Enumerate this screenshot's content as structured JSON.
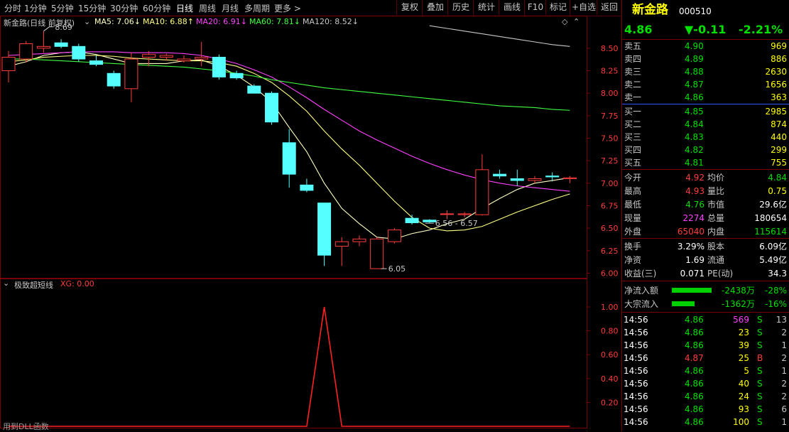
{
  "toolbar": {
    "periods": [
      "分时",
      "1分钟",
      "5分钟",
      "15分钟",
      "30分钟",
      "60分钟",
      "日线",
      "周线",
      "月线",
      "多周期",
      "更多 >"
    ],
    "active_period": "日线",
    "actions": [
      "复权",
      "叠加",
      "历史",
      "统计",
      "画线",
      "F10",
      "标记",
      "+自选",
      "返回"
    ]
  },
  "chart_header": {
    "title": "新金路(日线 前复权)",
    "ma5": "MA5: 7.06↓",
    "ma10": "MA10: 6.88↑",
    "ma20": "MA20: 6.91↓",
    "ma60": "MA60: 7.81↓",
    "ma120": "MA120: 8.52↓"
  },
  "chart_data": {
    "type": "candlestick",
    "y_ticks": [
      "8.50",
      "8.25",
      "8.00",
      "7.75",
      "7.50",
      "7.25",
      "7.00",
      "6.75",
      "6.50",
      "6.25",
      "6.00"
    ],
    "ylim": [
      5.98,
      8.72
    ],
    "candles": [
      {
        "o": 8.25,
        "h": 8.47,
        "l": 8.12,
        "c": 8.4
      },
      {
        "o": 8.38,
        "h": 8.58,
        "l": 8.34,
        "c": 8.55
      },
      {
        "o": 8.5,
        "h": 8.69,
        "l": 8.45,
        "c": 8.52
      },
      {
        "o": 8.56,
        "h": 8.6,
        "l": 8.5,
        "c": 8.52
      },
      {
        "o": 8.52,
        "h": 8.55,
        "l": 8.35,
        "c": 8.38
      },
      {
        "o": 8.36,
        "h": 8.42,
        "l": 8.3,
        "c": 8.32
      },
      {
        "o": 8.22,
        "h": 8.25,
        "l": 8.05,
        "c": 8.08
      },
      {
        "o": 8.05,
        "h": 8.45,
        "l": 7.9,
        "c": 8.38
      },
      {
        "o": 8.4,
        "h": 8.47,
        "l": 8.3,
        "c": 8.43
      },
      {
        "o": 8.4,
        "h": 8.44,
        "l": 8.36,
        "c": 8.42
      },
      {
        "o": 8.36,
        "h": 8.42,
        "l": 8.34,
        "c": 8.38
      },
      {
        "o": 8.38,
        "h": 8.57,
        "l": 8.3,
        "c": 8.4
      },
      {
        "o": 8.4,
        "h": 8.43,
        "l": 8.15,
        "c": 8.18
      },
      {
        "o": 8.22,
        "h": 8.25,
        "l": 8.15,
        "c": 8.17
      },
      {
        "o": 8.08,
        "h": 8.1,
        "l": 8.0,
        "c": 8.0
      },
      {
        "o": 8.0,
        "h": 8.02,
        "l": 7.65,
        "c": 7.68
      },
      {
        "o": 7.45,
        "h": 7.6,
        "l": 6.95,
        "c": 7.1
      },
      {
        "o": 6.98,
        "h": 7.05,
        "l": 6.9,
        "c": 6.92
      },
      {
        "o": 6.78,
        "h": 6.78,
        "l": 6.08,
        "c": 6.2
      },
      {
        "o": 6.3,
        "h": 6.4,
        "l": 6.08,
        "c": 6.35
      },
      {
        "o": 6.35,
        "h": 6.42,
        "l": 6.3,
        "c": 6.38
      },
      {
        "o": 6.05,
        "h": 6.4,
        "l": 6.05,
        "c": 6.38
      },
      {
        "o": 6.35,
        "h": 6.5,
        "l": 6.33,
        "c": 6.48
      },
      {
        "o": 6.61,
        "h": 6.65,
        "l": 6.54,
        "c": 6.56
      },
      {
        "o": 6.59,
        "h": 6.6,
        "l": 6.56,
        "c": 6.57
      },
      {
        "o": 6.66,
        "h": 6.7,
        "l": 6.6,
        "c": 6.66
      },
      {
        "o": 6.65,
        "h": 6.68,
        "l": 6.62,
        "c": 6.66
      },
      {
        "o": 6.65,
        "h": 7.32,
        "l": 6.64,
        "c": 7.15
      },
      {
        "o": 7.1,
        "h": 7.15,
        "l": 7.05,
        "c": 7.08
      },
      {
        "o": 7.05,
        "h": 7.15,
        "l": 6.97,
        "c": 7.03
      },
      {
        "o": 7.03,
        "h": 7.08,
        "l": 7.0,
        "c": 7.05
      },
      {
        "o": 7.08,
        "h": 7.12,
        "l": 7.02,
        "c": 7.07
      },
      {
        "o": 7.05,
        "h": 7.08,
        "l": 7.0,
        "c": 7.06
      }
    ],
    "ma_series": [
      {
        "name": "MA5",
        "color": "#ffffc0",
        "values": [
          8.3,
          8.35,
          8.42,
          8.45,
          8.46,
          8.43,
          8.38,
          8.33,
          8.33,
          8.33,
          8.36,
          8.37,
          8.3,
          8.2,
          8.07,
          7.9,
          7.62,
          7.35,
          7.0,
          6.72,
          6.55,
          6.4,
          6.38,
          6.44,
          6.48,
          6.55,
          6.6,
          6.72,
          6.83,
          6.93,
          7.0,
          7.03,
          7.06
        ]
      },
      {
        "name": "MA10",
        "color": "#ffff80",
        "values": [
          8.35,
          8.37,
          8.4,
          8.41,
          8.42,
          8.42,
          8.41,
          8.39,
          8.38,
          8.37,
          8.36,
          8.36,
          8.34,
          8.3,
          8.22,
          8.12,
          7.97,
          7.8,
          7.58,
          7.38,
          7.2,
          7.0,
          6.8,
          6.62,
          6.5,
          6.47,
          6.48,
          6.52,
          6.6,
          6.68,
          6.75,
          6.82,
          6.88
        ]
      },
      {
        "name": "MA20",
        "color": "#ff40ff",
        "values": [
          8.42,
          8.43,
          8.44,
          8.45,
          8.46,
          8.46,
          8.46,
          8.45,
          8.45,
          8.45,
          8.44,
          8.42,
          8.38,
          8.33,
          8.26,
          8.18,
          8.07,
          7.95,
          7.82,
          7.7,
          7.58,
          7.48,
          7.39,
          7.3,
          7.22,
          7.15,
          7.09,
          7.04,
          7.0,
          6.97,
          6.95,
          6.93,
          6.91
        ]
      },
      {
        "name": "MA60",
        "color": "#40ff40",
        "values": [
          8.38,
          8.38,
          8.37,
          8.36,
          8.35,
          8.34,
          8.33,
          8.32,
          8.31,
          8.3,
          8.29,
          8.27,
          8.25,
          8.22,
          8.19,
          8.15,
          8.12,
          8.09,
          8.06,
          8.04,
          8.02,
          8.0,
          7.98,
          7.96,
          7.94,
          7.92,
          7.9,
          7.88,
          7.86,
          7.85,
          7.84,
          7.82,
          7.81
        ]
      },
      {
        "name": "MA120",
        "color": "#c8c8c8",
        "start": 24,
        "values": [
          8.75,
          8.72,
          8.69,
          8.66,
          8.63,
          8.6,
          8.57,
          8.54,
          8.52
        ]
      }
    ],
    "annotations": {
      "high": "8.69",
      "low": "6.05",
      "range": "6.56 - 6.57"
    },
    "indicator": {
      "title": "极致超短线",
      "value_label": "XG: 0.00",
      "y_ticks": [
        "1.00",
        "0.80",
        "0.60",
        "0.40",
        "0.20"
      ],
      "values": [
        0,
        0,
        0,
        0,
        0,
        0,
        0,
        0,
        0,
        0,
        0,
        0,
        0,
        0,
        0,
        0,
        0,
        0,
        1,
        0,
        0,
        0,
        0,
        0,
        0,
        0,
        0,
        0,
        0,
        0,
        0,
        0,
        0
      ]
    },
    "footer_note": "用到DLL函数"
  },
  "quote": {
    "name": "新金路",
    "code": "000510",
    "price": "4.86",
    "change": "▼-0.11",
    "change_pct": "-2.21%",
    "asks": [
      {
        "label": "卖五",
        "price": "4.90",
        "vol": "969"
      },
      {
        "label": "卖四",
        "price": "4.89",
        "vol": "886"
      },
      {
        "label": "卖三",
        "price": "4.88",
        "vol": "2630"
      },
      {
        "label": "卖二",
        "price": "4.87",
        "vol": "1656"
      },
      {
        "label": "卖一",
        "price": "4.86",
        "vol": "363"
      }
    ],
    "bids": [
      {
        "label": "买一",
        "price": "4.85",
        "vol": "2985"
      },
      {
        "label": "买二",
        "price": "4.84",
        "vol": "874"
      },
      {
        "label": "买三",
        "price": "4.83",
        "vol": "440"
      },
      {
        "label": "买四",
        "price": "4.82",
        "vol": "299"
      },
      {
        "label": "买五",
        "price": "4.81",
        "vol": "755"
      }
    ],
    "stats": [
      {
        "l1": "今开",
        "v1": "4.92",
        "c1": "red",
        "l2": "均价",
        "v2": "4.84",
        "c2": "green"
      },
      {
        "l1": "最高",
        "v1": "4.93",
        "c1": "red",
        "l2": "量比",
        "v2": "0.75",
        "c2": "yellow"
      },
      {
        "l1": "最低",
        "v1": "4.76",
        "c1": "green",
        "l2": "市值",
        "v2": "29.6亿",
        "c2": "white"
      },
      {
        "l1": "现量",
        "v1": "2274",
        "c1": "magenta",
        "l2": "总量",
        "v2": "180654",
        "c2": "white"
      },
      {
        "l1": "外盘",
        "v1": "65040",
        "c1": "red",
        "l2": "内盘",
        "v2": "115614",
        "c2": "green"
      }
    ],
    "stats2": [
      {
        "l1": "换手",
        "v1": "3.29%",
        "l2": "股本",
        "v2": "6.09亿"
      },
      {
        "l1": "净资",
        "v1": "1.69",
        "l2": "流通",
        "v2": "5.49亿"
      },
      {
        "l1": "收益(三)",
        "v1": "0.071",
        "l2": "PE(动)",
        "v2": "34.3"
      }
    ],
    "flows": [
      {
        "label": "净流入额",
        "value": "-2438万",
        "pct": "-28%",
        "bar": 0.28
      },
      {
        "label": "大宗流入",
        "value": "-1362万",
        "pct": "-16%",
        "bar": 0.16
      }
    ],
    "ticks": [
      {
        "time": "14:56",
        "price": "4.86",
        "vol": "569",
        "side": "S",
        "n": "13",
        "vc": "magenta"
      },
      {
        "time": "14:56",
        "price": "4.86",
        "vol": "23",
        "side": "S",
        "n": "2",
        "vc": "yellow"
      },
      {
        "time": "14:56",
        "price": "4.86",
        "vol": "39",
        "side": "S",
        "n": "1",
        "vc": "yellow"
      },
      {
        "time": "14:56",
        "price": "4.87",
        "vol": "25",
        "side": "B",
        "n": "2",
        "vc": "yellow"
      },
      {
        "time": "14:56",
        "price": "4.86",
        "vol": "5",
        "side": "S",
        "n": "1",
        "vc": "yellow"
      },
      {
        "time": "14:56",
        "price": "4.86",
        "vol": "40",
        "side": "S",
        "n": "2",
        "vc": "yellow"
      },
      {
        "time": "14:56",
        "price": "4.86",
        "vol": "24",
        "side": "S",
        "n": "2",
        "vc": "yellow"
      },
      {
        "time": "14:56",
        "price": "4.86",
        "vol": "93",
        "side": "S",
        "n": "6",
        "vc": "yellow"
      },
      {
        "time": "14:56",
        "price": "4.86",
        "vol": "100",
        "side": "S",
        "n": "1",
        "vc": "yellow"
      }
    ]
  }
}
